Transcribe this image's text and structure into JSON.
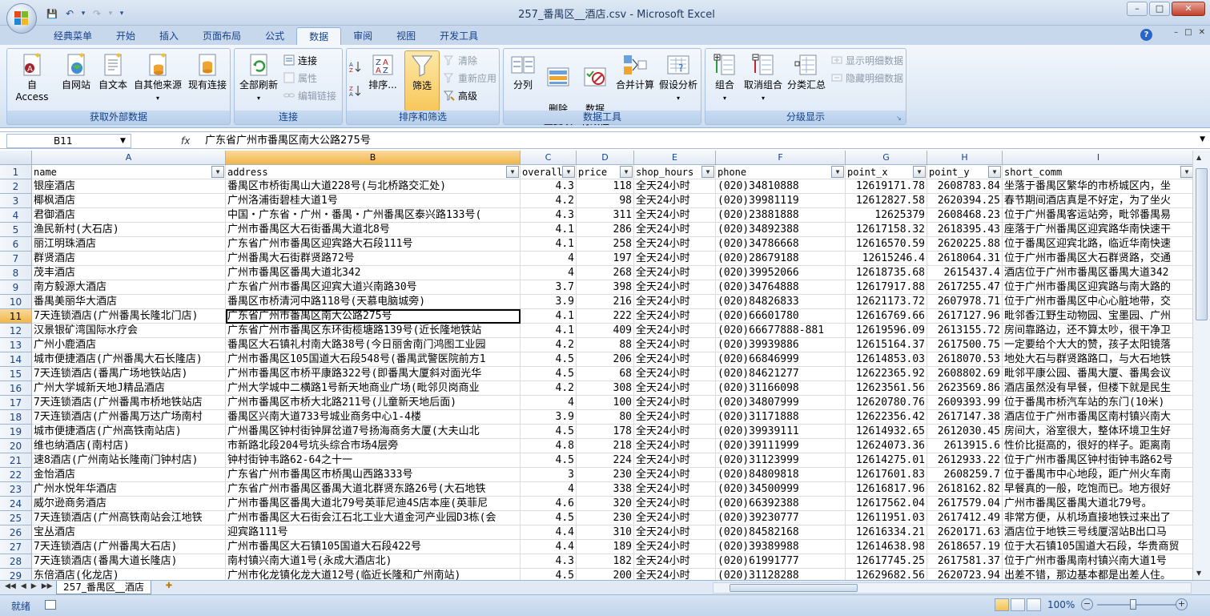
{
  "window": {
    "title": "257_番禺区__酒店.csv - Microsoft Excel",
    "min": "–",
    "max": "□",
    "close": "✕"
  },
  "qat": {
    "save": "💾",
    "undo": "↶",
    "redo": "↷",
    "more": "▾"
  },
  "ribbon_tabs": [
    "经典菜单",
    "开始",
    "插入",
    "页面布局",
    "公式",
    "数据",
    "审阅",
    "视图",
    "开发工具"
  ],
  "active_tab": "数据",
  "help": "?",
  "groups": {
    "external": {
      "label": "获取外部数据",
      "buttons": [
        "自 Access",
        "自网站",
        "自文本",
        "自其他来源",
        "现有连接"
      ]
    },
    "connections": {
      "label": "连接",
      "refresh": "全部刷新",
      "items": [
        "连接",
        "属性",
        "编辑链接"
      ]
    },
    "sort": {
      "label": "排序和筛选",
      "sort_btn": "排序...",
      "filter_btn": "筛选",
      "items": [
        "清除",
        "重新应用",
        "高级"
      ]
    },
    "tools": {
      "label": "数据工具",
      "buttons": [
        "分列",
        "删除\n重复项",
        "数据\n有效性",
        "合并计算",
        "假设分析"
      ]
    },
    "outline": {
      "label": "分级显示",
      "buttons": [
        "组合",
        "取消组合",
        "分类汇总"
      ],
      "items": [
        "显示明细数据",
        "隐藏明细数据"
      ]
    }
  },
  "formula_bar": {
    "name_box": "B11",
    "fx": "fx",
    "formula": "广东省广州市番禺区南大公路275号"
  },
  "columns": [
    "A",
    "B",
    "C",
    "D",
    "E",
    "F",
    "G",
    "H",
    "I"
  ],
  "headers": [
    "name",
    "address",
    "overall",
    "price",
    "shop_hours",
    "phone",
    "point_x",
    "point_y",
    "short_comm"
  ],
  "rows": [
    [
      "银座酒店",
      "番禺区市桥街禺山大道228号(与北桥路交汇处)",
      "4.3",
      "118",
      "全天24小时",
      "(020)34810888",
      "12619171.78",
      "2608783.84",
      "坐落于番禺区繁华的市桥城区内，坐"
    ],
    [
      "椰枫酒店",
      "广州洛浦街碧桂大道1号",
      "4.2",
      "98",
      "全天24小时",
      "(020)39981119",
      "12612827.58",
      "2620394.25",
      "春节期间酒店真是不好定，为了坐火"
    ],
    [
      "君御酒店",
      "中国・广东省・广州・番禺・广州番禺区泰兴路133号(",
      "4.3",
      "311",
      "全天24小时",
      "(020)23881888",
      "12625379",
      "2608468.23",
      "位于广州番禺客运站旁，毗邻番禺易"
    ],
    [
      "渔民新村(大石店)",
      "广州市番禺区大石街番禺大道北8号",
      "4.1",
      "286",
      "全天24小时",
      "(020)34892388",
      "12617158.32",
      "2618395.43",
      "座落于广州番禺区迎宾路华南快速干"
    ],
    [
      "丽江明珠酒店",
      "广东省广州市番禺区迎宾路大石段111号",
      "4.1",
      "258",
      "全天24小时",
      "(020)34786668",
      "12616570.59",
      "2620225.88",
      "位于番禺区迎宾北路，临近华南快速"
    ],
    [
      "群贤酒店",
      "广州番禺大石街群贤路72号",
      "4",
      "197",
      "全天24小时",
      "(020)28679188",
      "12615246.4",
      "2618064.31",
      "位于广州市番禺区大石群贤路，交通"
    ],
    [
      "茂丰酒店",
      "广州市番禺区番禺大道北342",
      "4",
      "268",
      "全天24小时",
      "(020)39952066",
      "12618735.68",
      "2615437.4",
      "酒店位于广州市番禺区番禺大道342"
    ],
    [
      "南方毅源大酒店",
      "广东省广州市番禺区迎宾大道兴南路30号",
      "3.7",
      "398",
      "全天24小时",
      "(020)34764888",
      "12617917.88",
      "2617255.47",
      "位于广州市番禺区迎宾路与南大路的"
    ],
    [
      "番禺美丽华大酒店",
      "番禺区市桥清河中路118号(天慕电脑城旁)",
      "3.9",
      "216",
      "全天24小时",
      "(020)84826833",
      "12621173.72",
      "2607978.71",
      "位于广州市番禺区中心心脏地带，交"
    ],
    [
      "7天连锁酒店(广州番禺长隆北门店)",
      "广东省广州市番禺区南大公路275号",
      "4.1",
      "222",
      "全天24小时",
      "(020)66601780",
      "12616769.66",
      "2617127.96",
      "毗邻香江野生动物园、宝墨园、广州"
    ],
    [
      "汉景银矿湾国际水疗会",
      "广东省广州市番禺区东环街榄塘路139号(近长隆地铁站",
      "4.1",
      "409",
      "全天24小时",
      "(020)66677888-881",
      "12619596.09",
      "2613155.72",
      "房间靠路边，还不算太吵，很干净卫"
    ],
    [
      "广州小鹿酒店",
      "番禺区大石镇礼村南大路38号(今日丽舍南门鸿图工业园",
      "4.2",
      "88",
      "全天24小时",
      "(020)39939886",
      "12615164.37",
      "2617500.75",
      "一定要给个大大的赞，孩子太阳镜落"
    ],
    [
      "城市便捷酒店(广州番禺大石长隆店)",
      "广州市番禺区105国道大石段548号(番禺武警医院前方1",
      "4.5",
      "206",
      "全天24小时",
      "(020)66846999",
      "12614853.03",
      "2618070.53",
      "地处大石与群贤路路口，与大石地铁"
    ],
    [
      "7天连锁酒店(番禺广场地铁站店)",
      "广州市番禺区市桥平康路322号(即番禺大厦斜对面光华",
      "4.5",
      "68",
      "全天24小时",
      "(020)84621277",
      "12622365.92",
      "2608802.69",
      "毗邻平康公园、番禺大厦、番禺会议"
    ],
    [
      "广州大学城新天地J精品酒店",
      "广州大学城中二横路1号新天地商业广场(毗邻贝岗商业",
      "4.2",
      "308",
      "全天24小时",
      "(020)31166098",
      "12623561.56",
      "2623569.86",
      "酒店虽然没有早餐，但楼下就是民生"
    ],
    [
      "7天连锁酒店(广州番禺市桥地铁站店",
      "广州市番禺区市桥大北路211号(儿童新天地后面)",
      "4",
      "100",
      "全天24小时",
      "(020)34807999",
      "12620780.76",
      "2609393.99",
      "位于番禺市桥汽车站的东门(10米)"
    ],
    [
      "7天连锁酒店(广州番禺万达广场南村",
      "番禺区兴南大道733号城业商务中心1-4楼",
      "3.9",
      "80",
      "全天24小时",
      "(020)31171888",
      "12622356.42",
      "2617147.38",
      "酒店位于广州市番禺区南村镇兴南大"
    ],
    [
      "城市便捷酒店(广州高铁南站店)",
      "广州番禺区钟村街钟屏岔道7号扬海商务大厦(大夫山北",
      "4.5",
      "178",
      "全天24小时",
      "(020)39939111",
      "12614932.65",
      "2612030.45",
      "房间大，浴室很大，整体环境卫生好"
    ],
    [
      "维也纳酒店(南村店)",
      "市新路北段204号坑头综合市场4层旁",
      "4.8",
      "218",
      "全天24小时",
      "(020)39111999",
      "12624073.36",
      "2613915.6",
      "性价比挺高的，很好的样子。距离南"
    ],
    [
      "速8酒店(广州南站长隆南门钟村店)",
      "钟村街钟韦路62-64之十一",
      "4.5",
      "224",
      "全天24小时",
      "(020)31123999",
      "12614275.01",
      "2612933.22",
      "位于广州市番禺区钟村街钟韦路62号"
    ],
    [
      "金怡酒店",
      "广东省广州市番禺区市桥禺山西路333号",
      "3",
      "230",
      "全天24小时",
      "(020)84809818",
      "12617601.83",
      "2608259.7",
      "位于番禺市中心地段，距广州火车南"
    ],
    [
      "广州水悦年华酒店",
      "广东省广州市番禺区番禺大道北群贤东路26号(大石地铁",
      "4",
      "338",
      "全天24小时",
      "(020)34500999",
      "12616817.96",
      "2618162.82",
      "早餐真的一般，吃饱而已。地方很好"
    ],
    [
      "威尔逊商务酒店",
      "广州市番禺区番禺大道北79号英菲尼迪4S店本座(英菲尼",
      "4.6",
      "320",
      "全天24小时",
      "(020)66392388",
      "12617562.04",
      "2617579.04",
      "广州市番禺区番禺大道北79号。"
    ],
    [
      "7天连锁酒店(广州高铁南站会江地铁",
      "广州市番禺区大石街会江石北工业大道金河产业园D3栋(会",
      "4.5",
      "230",
      "全天24小时",
      "(020)39230777",
      "12611951.03",
      "2617412.49",
      "非常方便，从机场直接地铁过来出了"
    ],
    [
      "宝丛酒店",
      "迎宾路111号",
      "4.4",
      "310",
      "全天24小时",
      "(020)84582168",
      "12616334.21",
      "2620171.63",
      "酒店位于地铁三号线厦滘站B出口马"
    ],
    [
      "7天连锁酒店(广州番禺大石店)",
      "广州市番禺区大石镇105国道大石段422号",
      "4.4",
      "189",
      "全天24小时",
      "(020)39389988",
      "12614638.98",
      "2618657.19",
      "位于大石镇105国道大石段，华贵商贸"
    ],
    [
      "7天连锁酒店(番禺大道长隆店)",
      "南村镇兴南大道1号(永成大酒店北)",
      "4.3",
      "182",
      "全天24小时",
      "(020)61991777",
      "12617745.25",
      "2617581.37",
      "位于广州市番禺南村镇兴南大道1号"
    ],
    [
      "东倍酒店(化龙店)",
      "广州市化龙镇化龙大道12号(临近长隆和广州南站)",
      "4.5",
      "200",
      "全天24小时",
      "(020)31128288",
      "12629682.56",
      "2620723.94",
      "出差不错，那边基本都是出差人住。"
    ]
  ],
  "sheet_tab": "257_番禺区__酒店",
  "status": {
    "text": "就绪",
    "zoom": "100%",
    "minus": "−",
    "plus": "+"
  }
}
